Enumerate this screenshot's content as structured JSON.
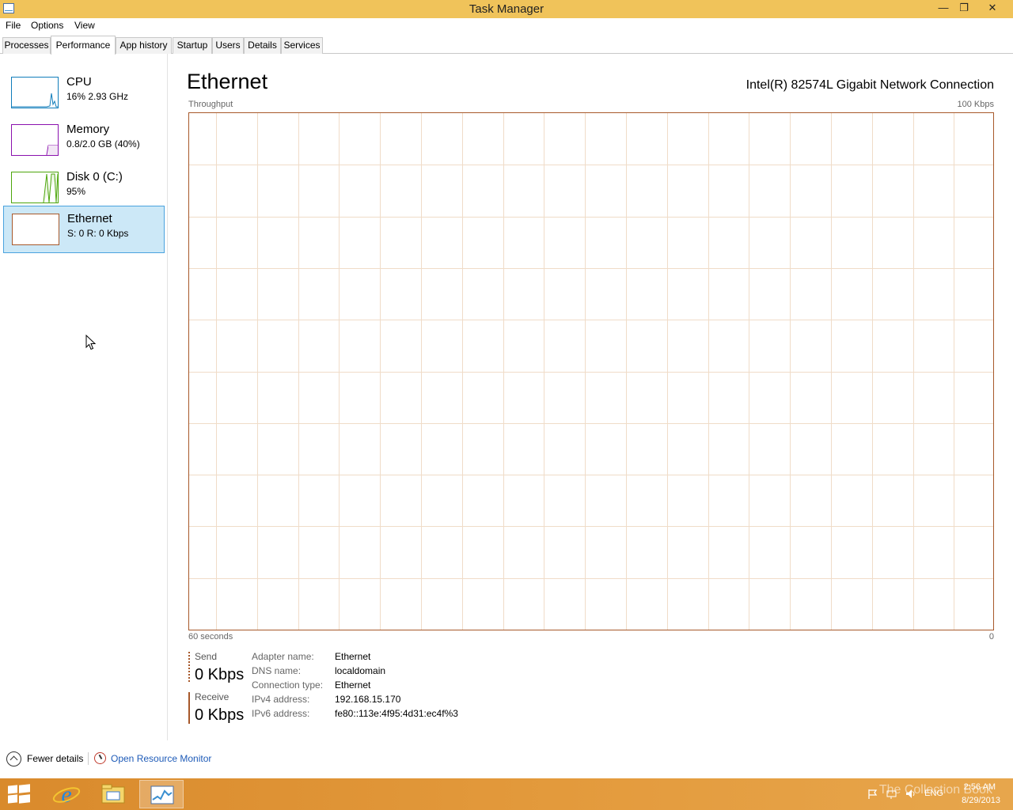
{
  "window": {
    "title": "Task Manager",
    "minimize": "—",
    "restore": "❐",
    "close": "✕"
  },
  "menu": [
    "File",
    "Options",
    "View"
  ],
  "tabs": [
    "Processes",
    "Performance",
    "App history",
    "Startup",
    "Users",
    "Details",
    "Services"
  ],
  "active_tab": "Performance",
  "sidebar": {
    "items": [
      {
        "name": "CPU",
        "sub": "16% 2.93 GHz",
        "color": "#117dbb",
        "icon": "cpu-graph-icon"
      },
      {
        "name": "Memory",
        "sub": "0.8/2.0 GB (40%)",
        "color": "#8b12ae",
        "icon": "memory-graph-icon"
      },
      {
        "name": "Disk 0 (C:)",
        "sub": "95%",
        "color": "#4da60c",
        "icon": "disk-graph-icon"
      },
      {
        "name": "Ethernet",
        "sub": "S: 0 R: 0 Kbps",
        "color": "#a7582a",
        "icon": "ethernet-graph-icon"
      }
    ],
    "selected": "Ethernet"
  },
  "main": {
    "title": "Ethernet",
    "adapter": "Intel(R) 82574L Gigabit Network Connection",
    "throughput_label": "Throughput",
    "max_label": "100 Kbps",
    "time_label": "60 seconds",
    "zero_label": "0"
  },
  "stats": {
    "send_label": "Send",
    "send_value": "0 Kbps",
    "receive_label": "Receive",
    "receive_value": "0 Kbps"
  },
  "properties": [
    {
      "label": "Adapter name:",
      "value": "Ethernet"
    },
    {
      "label": "DNS name:",
      "value": "localdomain"
    },
    {
      "label": "Connection type:",
      "value": "Ethernet"
    },
    {
      "label": "IPv4 address:",
      "value": "192.168.15.170"
    },
    {
      "label": "IPv6 address:",
      "value": "fe80::113e:4f95:4d31:ec4f%3"
    }
  ],
  "bottom": {
    "fewer_details": "Fewer details",
    "open_resource_monitor": "Open Resource Monitor"
  },
  "taskbar": {
    "lang": "ENG",
    "time": "2:56 AM",
    "date": "8/29/2013",
    "watermark": "The Collection Book"
  }
}
